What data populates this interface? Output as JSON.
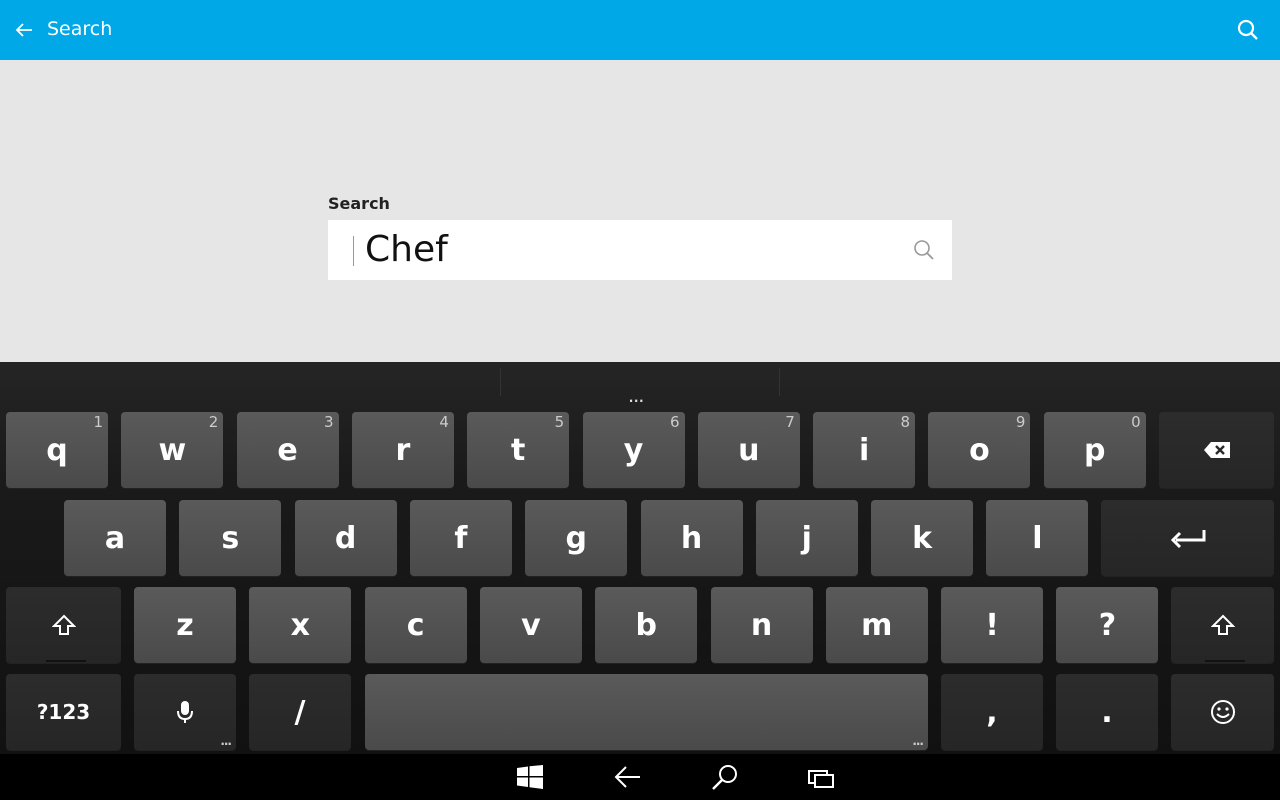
{
  "theme": {
    "accent": "#00a8e8"
  },
  "header": {
    "back_icon": "arrow-left-icon",
    "title": "Search",
    "search_icon": "search-icon"
  },
  "search": {
    "label": "Search",
    "value": "Chef",
    "icon": "search-icon"
  },
  "keyboard": {
    "suggestions_more": "...",
    "row1": [
      {
        "label": "q",
        "hint": "1"
      },
      {
        "label": "w",
        "hint": "2"
      },
      {
        "label": "e",
        "hint": "3"
      },
      {
        "label": "r",
        "hint": "4"
      },
      {
        "label": "t",
        "hint": "5"
      },
      {
        "label": "y",
        "hint": "6"
      },
      {
        "label": "u",
        "hint": "7"
      },
      {
        "label": "i",
        "hint": "8"
      },
      {
        "label": "o",
        "hint": "9"
      },
      {
        "label": "p",
        "hint": "0"
      }
    ],
    "row2": [
      "a",
      "s",
      "d",
      "f",
      "g",
      "h",
      "j",
      "k",
      "l"
    ],
    "row3": [
      "z",
      "x",
      "c",
      "v",
      "b",
      "n",
      "m",
      "!",
      "?"
    ],
    "symbols_label": "?123",
    "slash_label": "/",
    "comma_label": ",",
    "period_label": ".",
    "more_marker": "...",
    "icons": {
      "backspace": "backspace-icon",
      "enter": "enter-icon",
      "shift": "shift-icon",
      "mic": "microphone-icon",
      "emoji": "emoji-icon"
    }
  },
  "system_bar": {
    "icons": [
      "windows-start-icon",
      "back-icon",
      "search-icon",
      "task-view-icon"
    ]
  }
}
